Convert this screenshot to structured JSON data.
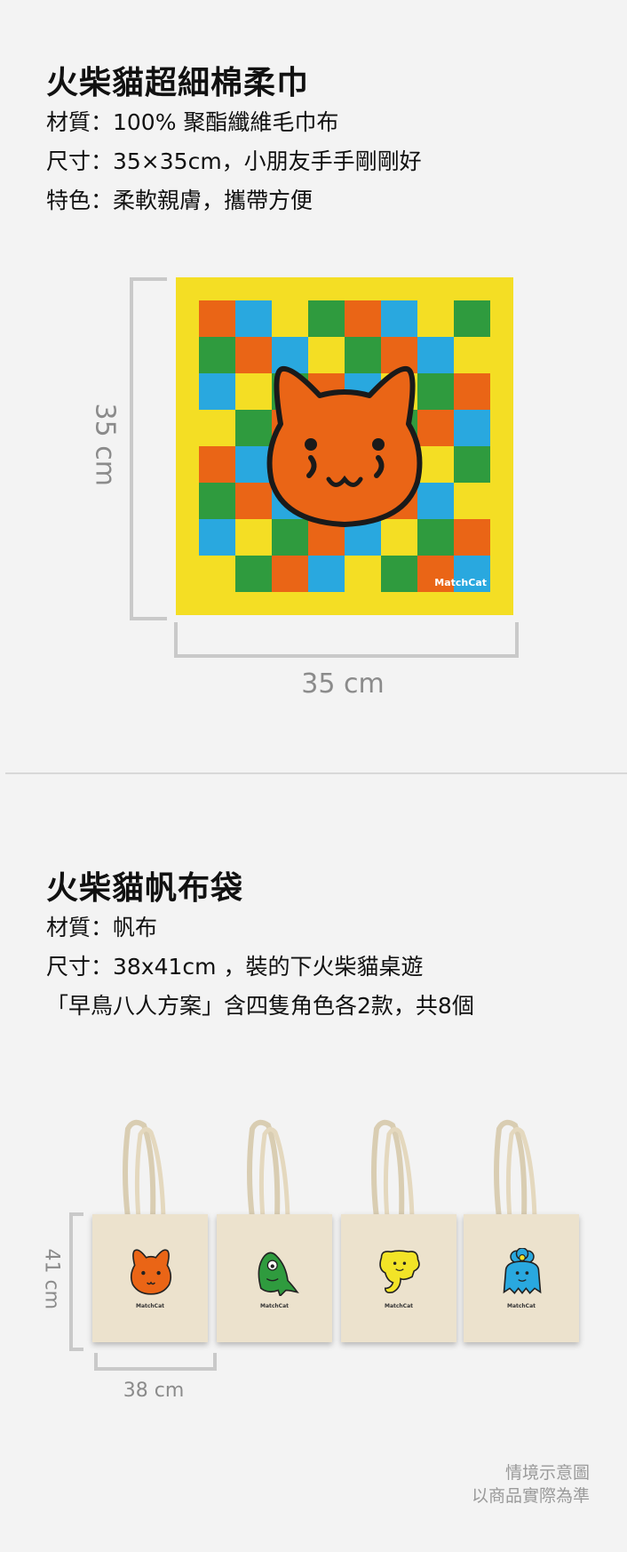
{
  "towel_section": {
    "title": "火柴貓超細棉柔巾",
    "lines": [
      "材質：100% 聚酯纖維毛巾布",
      "尺寸：35×35cm，小朋友手手剛剛好",
      "特色：柔軟親膚，攜帶方便"
    ],
    "dim_vertical": "35 cm",
    "dim_horizontal": "35 cm",
    "logo": "MatchCat"
  },
  "bag_section": {
    "title": "火柴貓帆布袋",
    "lines": [
      "材質：帆布",
      "尺寸：38x41cm ，裝的下火柴貓桌遊",
      "「早鳥八人方案」含四隻角色各2款，共8個"
    ],
    "dim_vertical": "41 cm",
    "dim_horizontal": "38 cm",
    "bags": [
      {
        "character": "orange-cat",
        "brand": "MatchCat"
      },
      {
        "character": "green-frog",
        "brand": "MatchCat"
      },
      {
        "character": "yellow-elephant",
        "brand": "MatchCat"
      },
      {
        "character": "blue-flower",
        "brand": "MatchCat"
      }
    ]
  },
  "note": {
    "line1": "情境示意圖",
    "line2": "以商品實際為準"
  },
  "colors": {
    "towel_bg": "#f4de24",
    "orange": "#ea6516",
    "blue": "#29a8df",
    "green": "#2f9b3e",
    "yellow": "#f4de24"
  }
}
